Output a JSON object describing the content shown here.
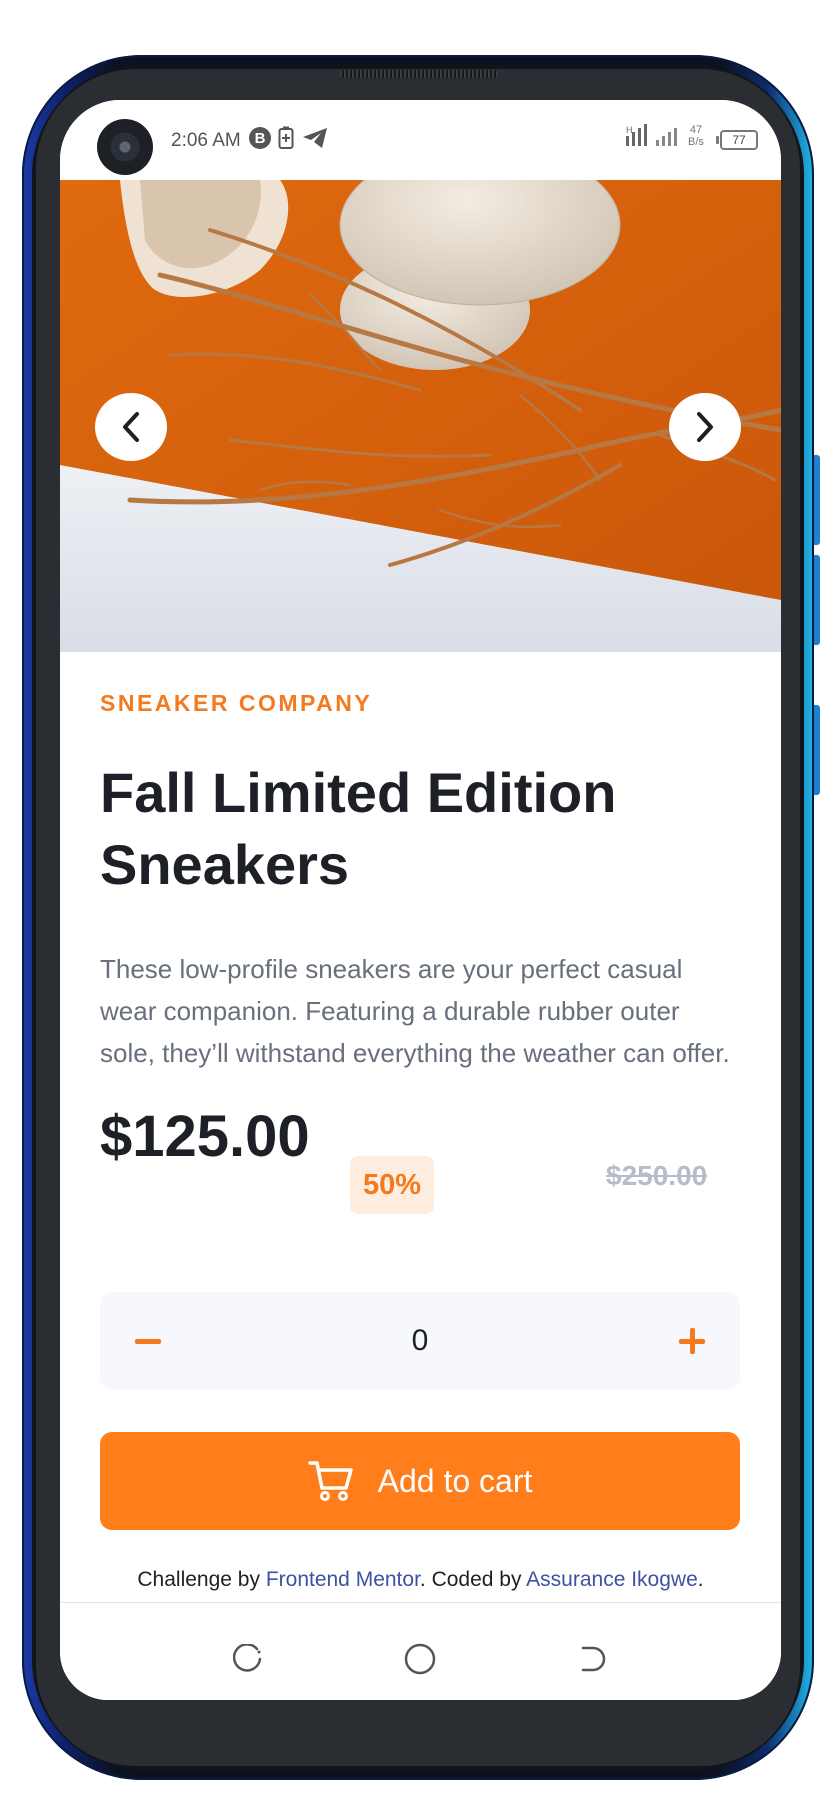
{
  "status_bar": {
    "time": "2:06 AM",
    "net_speed_value": "47",
    "net_speed_unit": "B/s",
    "battery": "77",
    "icons": [
      "b-badge-icon",
      "battery-saver-icon",
      "telegram-icon",
      "signal-icon",
      "wifi-icon"
    ]
  },
  "carousel": {
    "prev_icon": "chevron-left-icon",
    "next_icon": "chevron-right-icon"
  },
  "product": {
    "brand": "SNEAKER COMPANY",
    "title": "Fall Limited Edition Sneakers",
    "description": "These low-profile sneakers are your perfect casual wear companion. Featuring a durable rubber outer sole, they’ll withstand everything the weather can offer.",
    "price": "$125.00",
    "discount": "50%",
    "original_price": "$250.00"
  },
  "quantity": {
    "value": "0",
    "minus_icon": "minus-icon",
    "plus_icon": "plus-icon"
  },
  "cart_button": {
    "label": "Add to cart",
    "icon": "cart-icon"
  },
  "attribution": {
    "prefix": "Challenge by ",
    "link1": "Frontend Mentor",
    "middle": ". Coded by ",
    "link2": "Assurance Ikogwe",
    "suffix": "."
  },
  "colors": {
    "accent": "#ff7e1b",
    "accent_text": "#f47a1f",
    "accent_pale": "#ffede0",
    "dark": "#1d2026",
    "gray": "#68707d",
    "light_bg": "#f6f8fd",
    "link": "#3e52a3"
  }
}
